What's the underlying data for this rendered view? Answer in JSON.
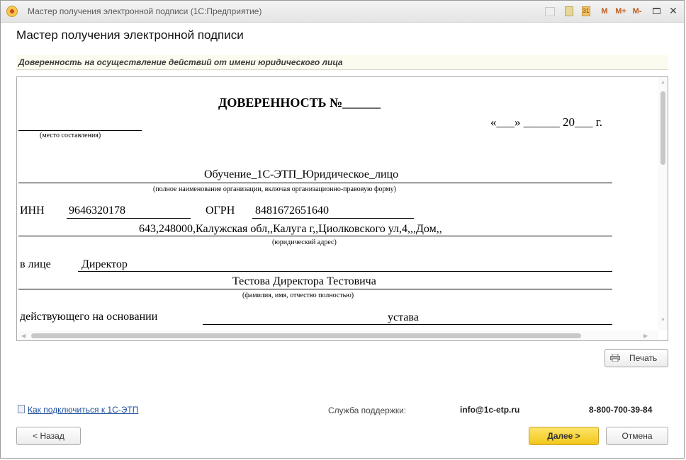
{
  "window": {
    "title": "Мастер получения электронной подписи  (1С:Предприятие)",
    "toolbar": {
      "m_label": "M",
      "mplus_label": "M+",
      "mminus_label": "M-",
      "calendar_label": "31",
      "close_label": "✕"
    }
  },
  "form": {
    "title": "Мастер получения электронной подписи",
    "section_header": "Доверенность на осуществление действий от имени юридического лица"
  },
  "document": {
    "heading": "ДОВЕРЕННОСТЬ    №______",
    "date_line": "«___» ______ 20___ г.",
    "place_caption": "(место составления)",
    "org_name": "Обучение_1С-ЭТП_Юридическое_лицо",
    "org_caption": "(полное наименование организации, включая организационно-правовую форму)",
    "inn_label": "ИНН",
    "inn_value": "9646320178",
    "ogrn_label": "ОГРН",
    "ogrn_value": "8481672651640",
    "address": "643,248000,Калужская обл,,Калуга г,,Циолковского ул,4,,,Дом,,",
    "address_caption": "(юридический адрес)",
    "in_person_label": "в лице",
    "position": "Директор",
    "person_name": "Тестова Директора Тестовича",
    "person_caption": "(фамилия, имя, отчество полностью)",
    "basis_label": "действующего на основании",
    "basis_value": "устава"
  },
  "buttons": {
    "print": "Печать",
    "back": "< Назад",
    "next": "Далее >",
    "cancel": "Отмена"
  },
  "footer": {
    "help_link": "Как подключиться к 1С-ЭТП",
    "support_label": "Служба поддержки:",
    "support_email": "info@1c-etp.ru",
    "support_phone": "8-800-700-39-84"
  }
}
